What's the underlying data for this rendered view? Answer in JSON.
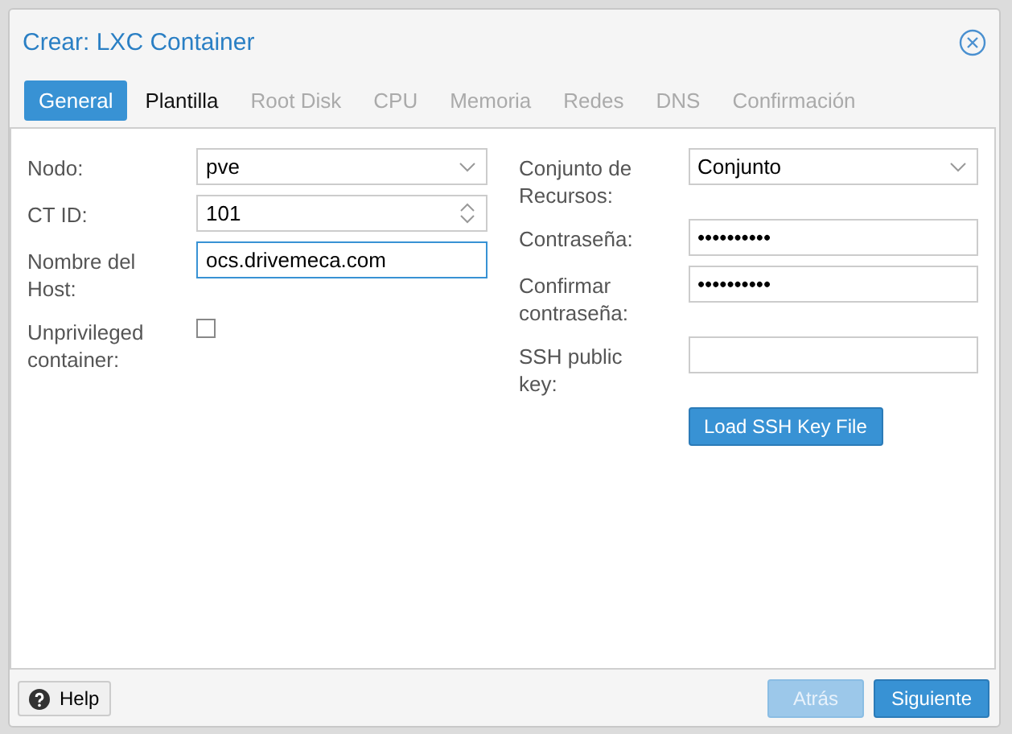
{
  "window": {
    "title": "Crear: LXC Container"
  },
  "tabs": [
    {
      "label": "General",
      "selected": true,
      "disabled": false
    },
    {
      "label": "Plantilla",
      "selected": false,
      "disabled": false
    },
    {
      "label": "Root Disk",
      "selected": false,
      "disabled": true
    },
    {
      "label": "CPU",
      "selected": false,
      "disabled": true
    },
    {
      "label": "Memoria",
      "selected": false,
      "disabled": true
    },
    {
      "label": "Redes",
      "selected": false,
      "disabled": true
    },
    {
      "label": "DNS",
      "selected": false,
      "disabled": true
    },
    {
      "label": "Confirmación",
      "selected": false,
      "disabled": true
    }
  ],
  "left_fields": [
    {
      "kind": "select",
      "label": "Nodo:",
      "value": "pve",
      "focused": false
    },
    {
      "kind": "number",
      "label": "CT ID:",
      "value": "101",
      "focused": false
    },
    {
      "kind": "text",
      "label": "Nombre del Host:",
      "value": "ocs.drivemeca.com",
      "focused": true
    },
    {
      "kind": "checkbox",
      "label": "Unprivileged container:",
      "checked": false
    }
  ],
  "right_fields": [
    {
      "kind": "select",
      "label": "Conjunto de Recursos:",
      "value": "Conjunto",
      "focused": false
    },
    {
      "kind": "password",
      "label": "Contraseña:",
      "value": "••••••••••",
      "focused": false
    },
    {
      "kind": "password",
      "label": "Confirmar contraseña:",
      "value": "••••••••••",
      "focused": false
    },
    {
      "kind": "text",
      "label": "SSH public key:",
      "focused": false
    }
  ],
  "load_button": "Load SSH Key File",
  "footer": {
    "help": "Help",
    "buttons": [
      {
        "label": "Atrás",
        "disabled": true
      },
      {
        "label": "Siguiente",
        "disabled": false
      }
    ]
  }
}
